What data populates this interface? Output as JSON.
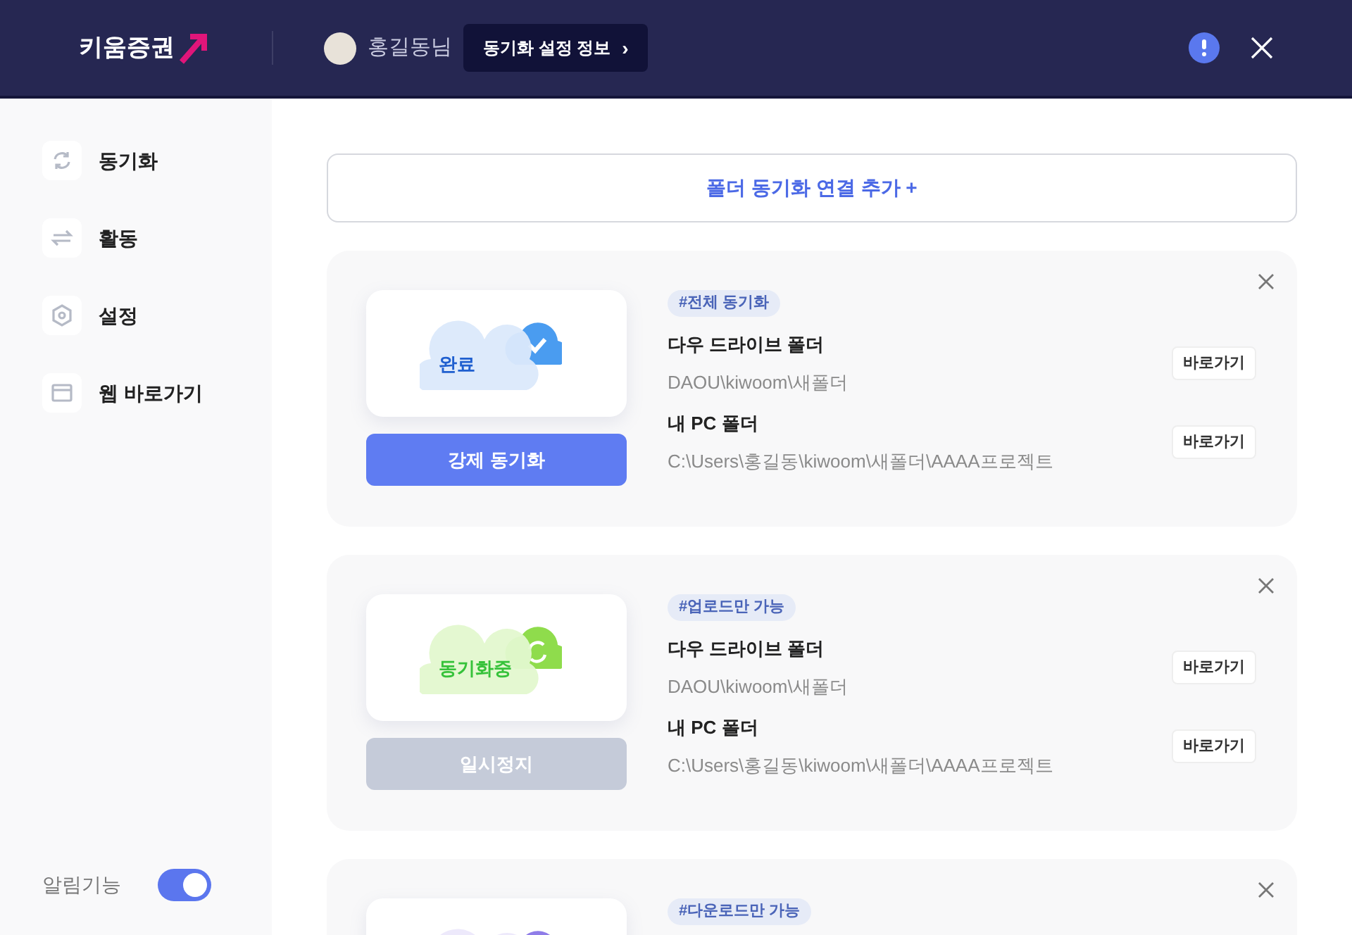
{
  "header": {
    "logo": "키움증권",
    "user": "홍길동님",
    "settings_button": "동기화 설정 정보",
    "settings_caret": "›"
  },
  "sidebar": {
    "items": [
      {
        "label": "동기화"
      },
      {
        "label": "활동"
      },
      {
        "label": "설정"
      },
      {
        "label": "웹 바로가기"
      }
    ],
    "notification": {
      "label": "알림기능",
      "on": true
    }
  },
  "add_button": "폴더 동기화 연결 추가 +",
  "cards": [
    {
      "kind": "done",
      "status_label": "완료",
      "tag": "#전체 동기화",
      "action": {
        "label": "강제 동기화",
        "disabled": false
      },
      "folders": [
        {
          "title": "다우 드라이브 폴더",
          "path": "DAOU\\kiwoom\\새폴더",
          "button": "바로가기"
        },
        {
          "title": "내 PC 폴더",
          "path": "C:\\Users\\홍길동\\kiwoom\\새폴더\\AAAA프로젝트",
          "button": "바로가기"
        }
      ]
    },
    {
      "kind": "syncing",
      "status_label": "동기화중",
      "tag": "#업로드만 가능",
      "action": {
        "label": "일시정지",
        "disabled": true
      },
      "folders": [
        {
          "title": "다우 드라이브 폴더",
          "path": "DAOU\\kiwoom\\새폴더",
          "button": "바로가기"
        },
        {
          "title": "내 PC 폴더",
          "path": "C:\\Users\\홍길동\\kiwoom\\새폴더\\AAAA프로젝트",
          "button": "바로가기"
        }
      ]
    },
    {
      "kind": "download",
      "tag": "#다운로드만 가능"
    }
  ]
}
